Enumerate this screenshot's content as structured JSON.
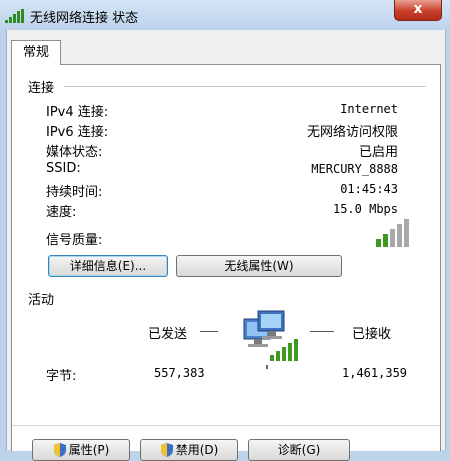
{
  "window": {
    "title": "无线网络连接 状态",
    "close_glyph": "x"
  },
  "tab": {
    "label": "常规"
  },
  "connection": {
    "title": "连接",
    "rows": [
      {
        "label": "IPv4 连接:",
        "value": "Internet"
      },
      {
        "label": "IPv6 连接:",
        "value": "无网络访问权限"
      },
      {
        "label": "媒体状态:",
        "value": "已启用"
      },
      {
        "label": "SSID:",
        "value": "MERCURY_8888"
      },
      {
        "label": "持续时间:",
        "value": "01:45:43"
      },
      {
        "label": "速度:",
        "value": "15.0 Mbps"
      }
    ],
    "signal_label": "信号质量:",
    "signal_bars": 5,
    "signal_bars_filled": 2,
    "details_button": "详细信息(E)...",
    "wireless_props_button": "无线属性(W)"
  },
  "activity": {
    "title": "活动",
    "sent_label": "已发送",
    "received_label": "已接收",
    "bytes_label": "字节:",
    "bytes_sent": "557,383",
    "bytes_received": "1,461,359"
  },
  "footer": {
    "properties_button": "属性(P)",
    "disable_button": "禁用(D)",
    "diagnose_button": "诊断(G)"
  },
  "colors": {
    "signal_green": "#3f9a1f",
    "signal_gray": "#a8a8a8",
    "close_red": "#c8402a"
  },
  "icons": [
    "network-bars-icon",
    "close-icon",
    "signal-strength-icon",
    "network-computers-icon",
    "shield-icon"
  ]
}
